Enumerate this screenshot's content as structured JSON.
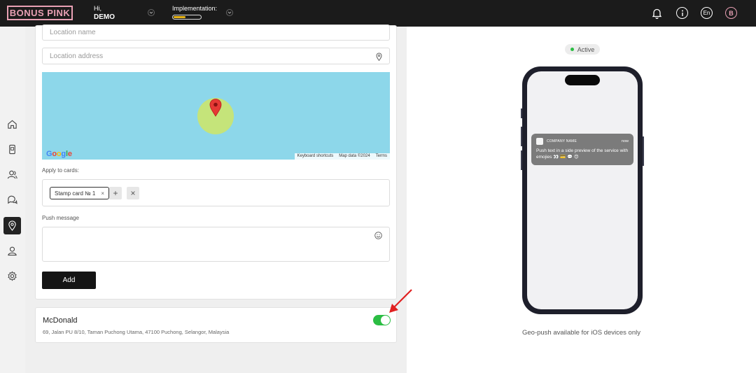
{
  "brand": {
    "logo_text": "BONUS PINK",
    "color": "#e8a0b4"
  },
  "header": {
    "greeting": "Hi,",
    "user_name": "DEMO",
    "implementation_label": "Implementation:",
    "implementation_progress": 0.45,
    "language": "En",
    "avatar_letter": "B",
    "icons": [
      "bell-icon",
      "info-icon",
      "language-icon",
      "avatar"
    ]
  },
  "sidebar": {
    "items": [
      {
        "name": "home-icon"
      },
      {
        "name": "mobile-card-icon"
      },
      {
        "name": "clients-icon"
      },
      {
        "name": "chat-icon"
      },
      {
        "name": "location-icon",
        "active": true
      },
      {
        "name": "profile-icon"
      },
      {
        "name": "settings-icon"
      }
    ]
  },
  "form": {
    "location_name_placeholder": "Location name",
    "location_address_placeholder": "Location address",
    "map": {
      "brand": "Google",
      "shortcuts": "Keyboard shortcuts",
      "data": "Map data ©2024",
      "terms": "Terms"
    },
    "apply_label": "Apply to cards:",
    "chip_label": "Stamp card № 1",
    "chip_remove": "×",
    "add_card_symbol": "+",
    "clear_symbol": "×",
    "push_label": "Push message",
    "push_value": "",
    "add_button": "Add"
  },
  "locations": [
    {
      "title": "McDonald",
      "address": "69, Jalan PU 8/10, Taman Puchong Utama, 47100 Puchong, Selangor, Malaysia",
      "enabled": true
    }
  ],
  "preview": {
    "status": "Active",
    "notification": {
      "app_name": "COMPANY NAME",
      "time": "now",
      "message": "Push text in a side preview of the service with emojies 👀 💳 💬 😍"
    },
    "note": "Geo-push available for iOS devices only"
  }
}
